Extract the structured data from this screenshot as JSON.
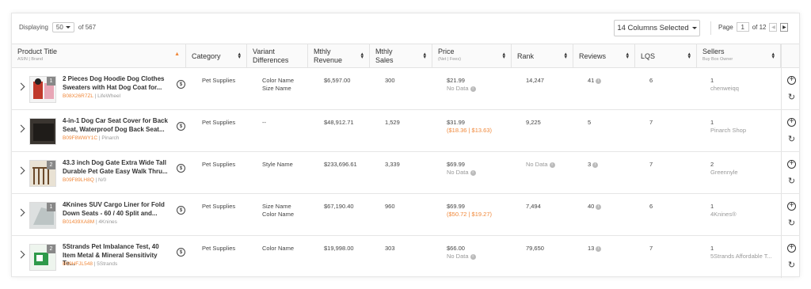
{
  "toolbar": {
    "displaying_label": "Displaying",
    "per_page": "50",
    "of_total": "of 567",
    "columns_selected": "14 Columns Selected",
    "page_label": "Page",
    "page_current": "1",
    "page_total": "of 12",
    "prev_icon": "chevron-left-icon",
    "next_icon": "chevron-right-icon"
  },
  "columns": {
    "title": {
      "label": "Product Title",
      "sub": "ASIN | Brand"
    },
    "category": {
      "label": "Category"
    },
    "variant": {
      "label1": "Variant",
      "label2": "Differences"
    },
    "revenue": {
      "label1": "Mthly",
      "label2": "Revenue"
    },
    "sales": {
      "label1": "Mthly",
      "label2": "Sales"
    },
    "price": {
      "label": "Price",
      "sub": "(Net | Fees)"
    },
    "rank": {
      "label": "Rank"
    },
    "reviews": {
      "label": "Reviews"
    },
    "lqs": {
      "label": "LQS"
    },
    "sellers": {
      "label": "Sellers",
      "sub": "Buy Box Owner"
    }
  },
  "rows": [
    {
      "badge": "1",
      "title_line1": "2 Pieces Dog Hoodie Dog Clothes",
      "title_line2": "Sweaters with Hat Dog Coat for...",
      "asin": "B08X26R7ZL",
      "brand": "| LifeWheel",
      "category": "Pet Supplies",
      "variant_line1": "Color Name",
      "variant_line2": "Size Name",
      "revenue": "$6,597.00",
      "sales": "300",
      "price": "$21.99",
      "price_sub": "No Data",
      "rank": "14,247",
      "reviews": "41",
      "lqs": "6",
      "sellers": "1",
      "seller_name": "chenweiqq"
    },
    {
      "badge": "",
      "title_line1": "4-in-1 Dog Car Seat Cover for Back",
      "title_line2": "Seat, Waterproof Dog Back Seat...",
      "asin": "B09F8WWY1C",
      "brand": "| Pinarch",
      "category": "Pet Supplies",
      "variant_line1": "--",
      "variant_line2": "",
      "revenue": "$48,912.71",
      "sales": "1,529",
      "price": "$31.99",
      "price_sub": "($18.36 | $13.63)",
      "rank": "9,225",
      "reviews": "5",
      "lqs": "7",
      "sellers": "1",
      "seller_name": "Pinarch Shop"
    },
    {
      "badge": "2",
      "title_line1": "43.3 inch Dog Gate Extra Wide Tall",
      "title_line2": "Durable Pet Gate Easy Walk Thru...",
      "asin": "B09F89LH8Q",
      "brand": "| N/0",
      "category": "Pet Supplies",
      "variant_line1": "Style Name",
      "variant_line2": "",
      "revenue": "$233,696.61",
      "sales": "3,339",
      "price": "$69.99",
      "price_sub": "No Data",
      "rank": "No Data",
      "reviews": "3",
      "lqs": "7",
      "sellers": "2",
      "seller_name": "Greennyle"
    },
    {
      "badge": "1",
      "title_line1": "4Knines SUV Cargo Liner for Fold",
      "title_line2": "Down Seats - 60 / 40 Split and...",
      "asin": "B01439XA8M",
      "brand": "| 4Knines",
      "category": "Pet Supplies",
      "variant_line1": "Size Name",
      "variant_line2": "Color Name",
      "revenue": "$67,190.40",
      "sales": "960",
      "price": "$69.99",
      "price_sub": "($50.72 | $19.27)",
      "rank": "7,494",
      "reviews": "40",
      "lqs": "6",
      "sellers": "1",
      "seller_name": "4Knines®"
    },
    {
      "badge": "2",
      "title_line1": "5Strands Pet Imbalance Test, 40",
      "title_line2": "Item Metal & Mineral Sensitivity Te...",
      "asin": "B09HFJL548",
      "brand": "| 5Strands",
      "category": "Pet Supplies",
      "variant_line1": "Color Name",
      "variant_line2": "",
      "revenue": "$19,998.00",
      "sales": "303",
      "price": "$66.00",
      "price_sub": "No Data",
      "rank": "79,650",
      "reviews": "13",
      "lqs": "7",
      "sellers": "1",
      "seller_name": "5Strands Affordable T..."
    }
  ],
  "colors": {
    "accent": "#f0883a",
    "muted": "#999999"
  }
}
